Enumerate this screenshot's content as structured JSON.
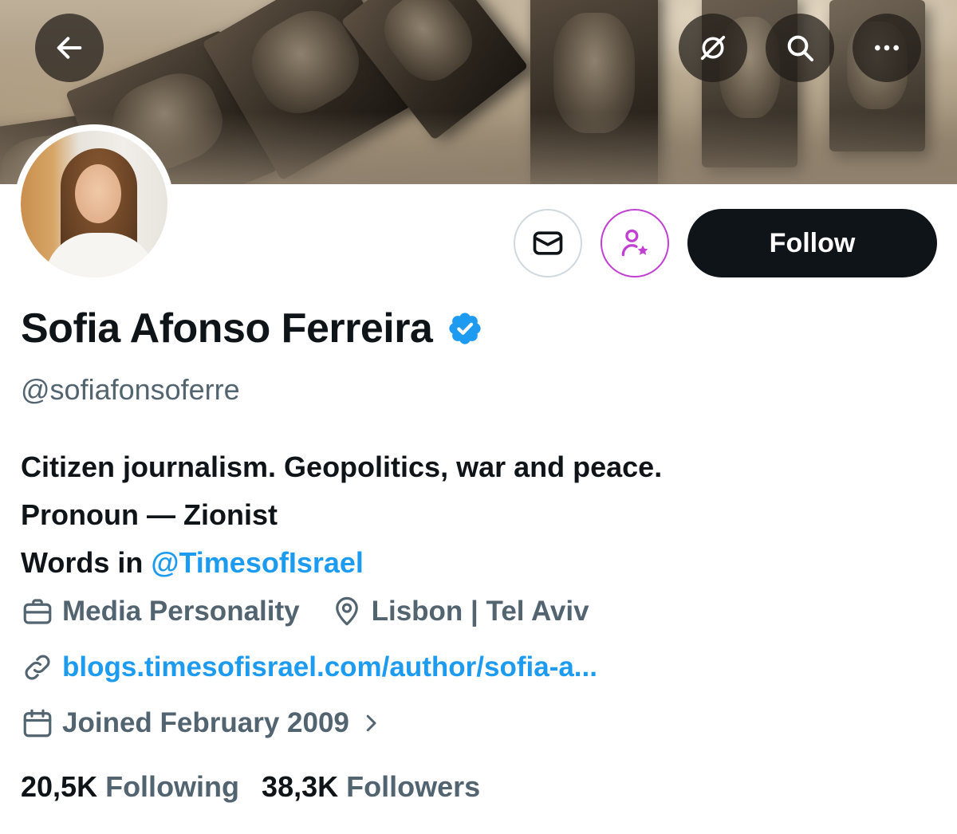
{
  "header": {
    "back_icon": "arrow-left-icon",
    "grok_icon": "grok-icon",
    "search_icon": "search-icon",
    "more_icon": "more-icon"
  },
  "actions": {
    "message_icon": "envelope-icon",
    "subscribe_icon": "person-star-icon",
    "follow_label": "Follow"
  },
  "profile": {
    "display_name": "Sofia Afonso Ferreira",
    "handle": "@sofiafonsoferre",
    "bio": {
      "line1": "Citizen journalism. Geopolitics, war and peace.",
      "line2": "Pronoun — Zionist",
      "line3_prefix": "Words in ",
      "line3_mention": "@TimesofIsrael"
    },
    "category": "Media Personality",
    "location": "Lisbon | Tel Aviv",
    "website": "blogs.timesofisrael.com/author/sofia-a...",
    "joined": "Joined February 2009",
    "following_count": "20,5K",
    "following_label": "Following",
    "followers_count": "38,3K",
    "followers_label": "Followers"
  },
  "colors": {
    "text_primary": "#0f1419",
    "text_secondary": "#536471",
    "link": "#1d9bf0",
    "subscribe_accent": "#c13fd3",
    "verified": "#1d9bf0"
  }
}
